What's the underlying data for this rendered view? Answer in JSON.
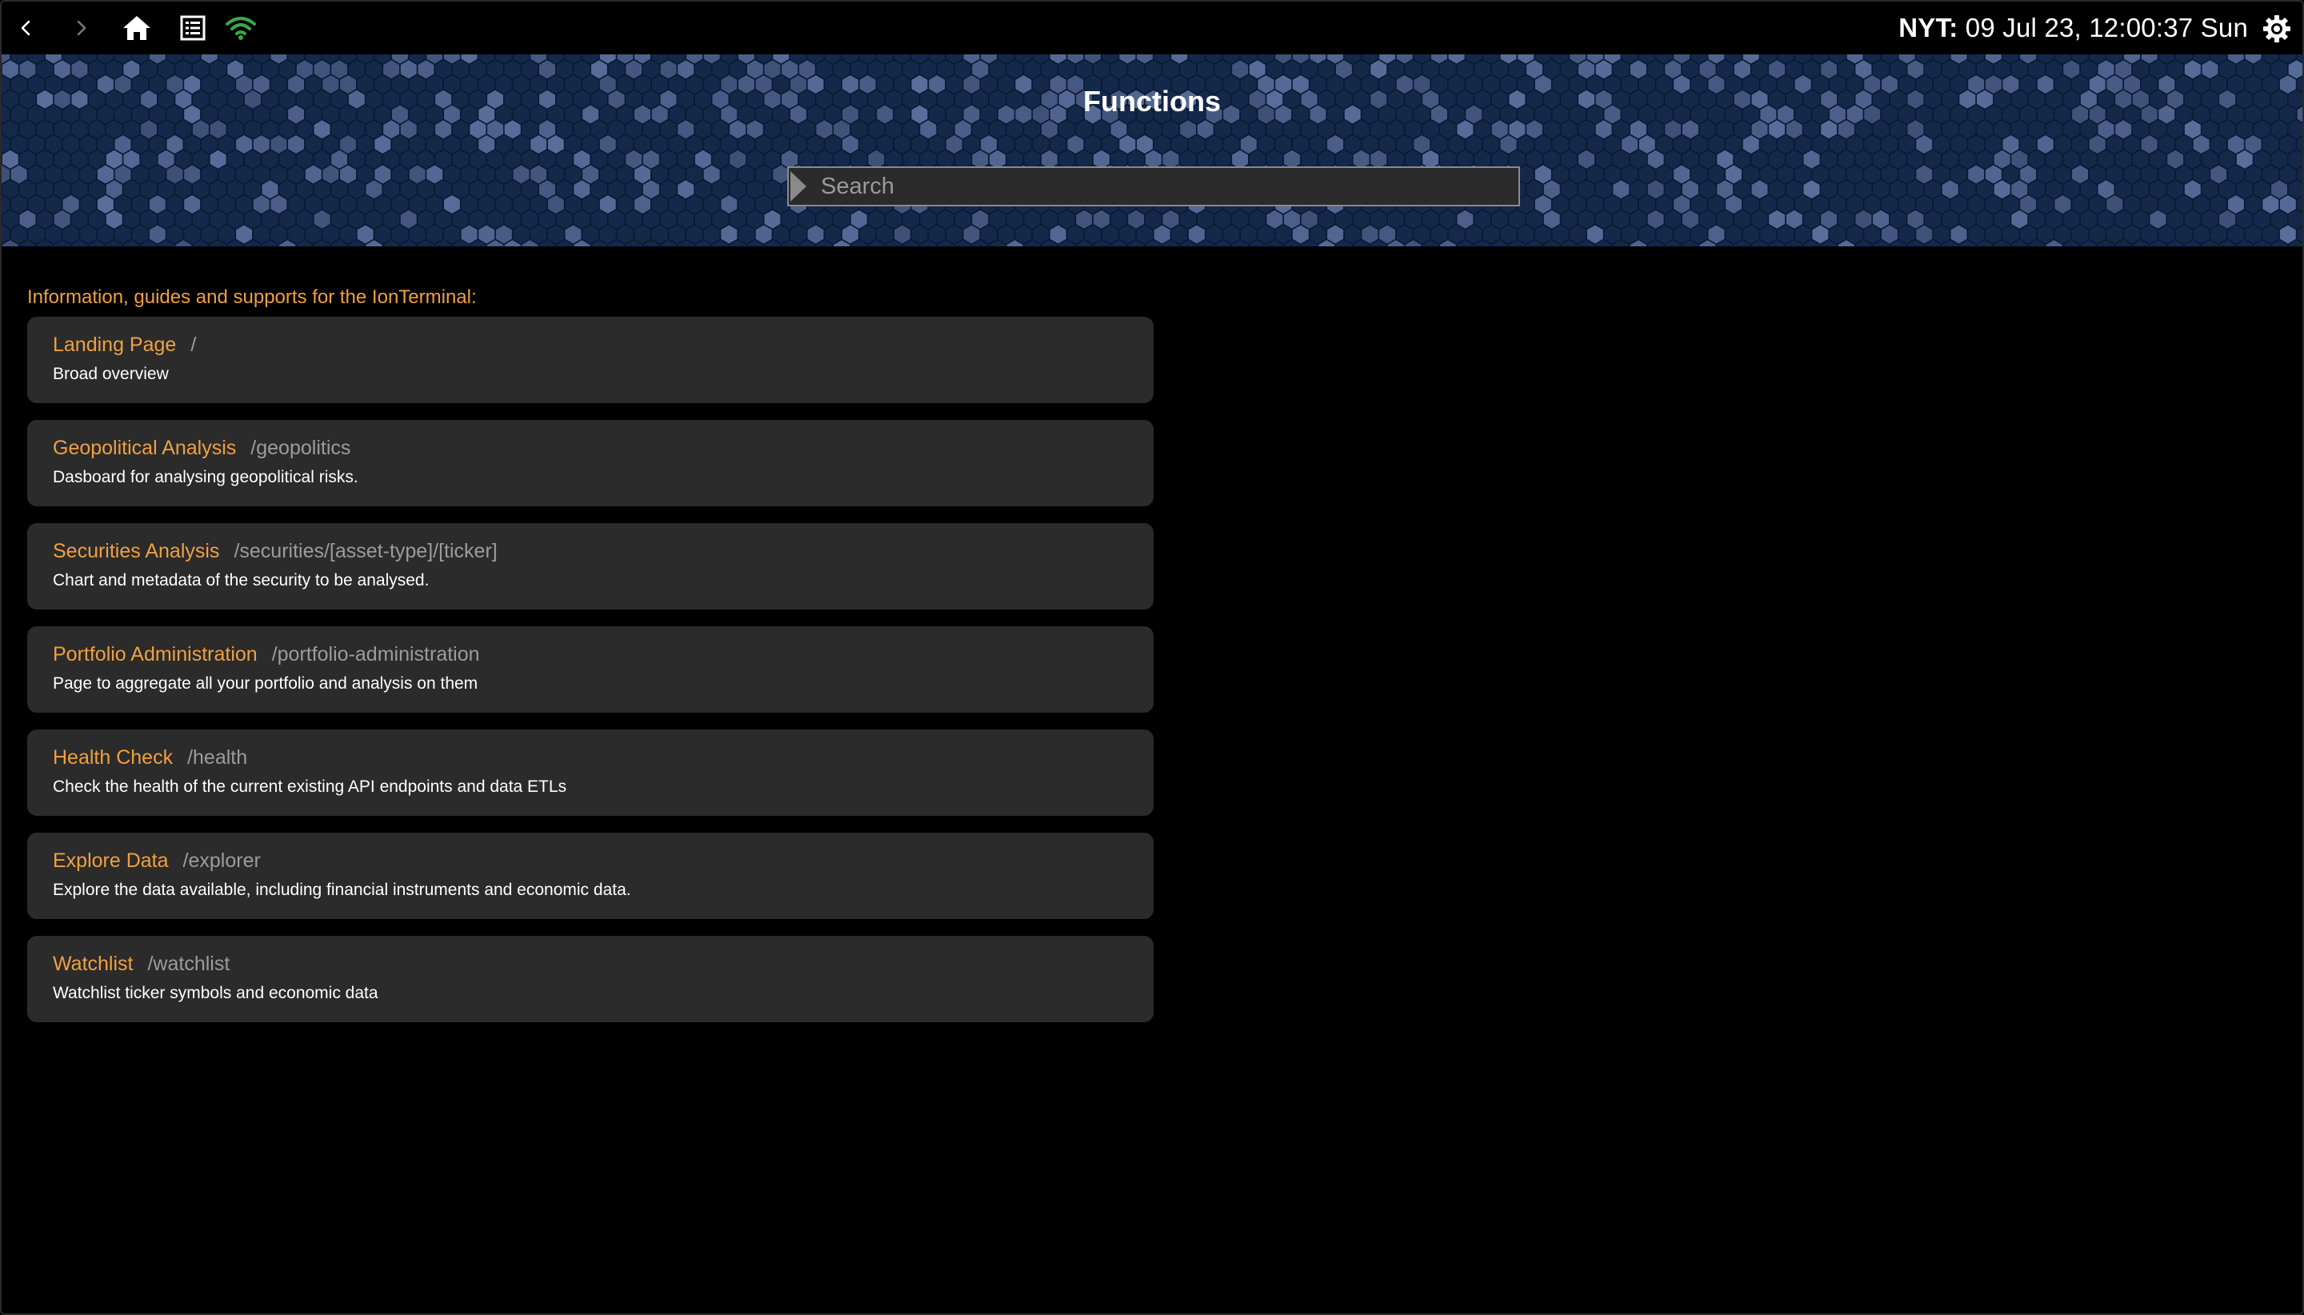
{
  "topbar": {
    "back_icon": "chevron-left-icon",
    "forward_icon": "chevron-right-icon",
    "home_icon": "home-icon",
    "list_icon": "list-icon",
    "wifi_icon": "wifi-icon",
    "clock_label": "NYT:",
    "clock_value": "09 Jul 23, 12:00:37 Sun",
    "settings_icon": "gear-icon",
    "colors": {
      "icon_active": "#ffffff",
      "icon_disabled": "#777777",
      "wifi": "#3aa84a"
    }
  },
  "banner": {
    "title": "Functions",
    "search_placeholder": "Search",
    "search_value": ""
  },
  "main": {
    "intro": "Information, guides and supports for the IonTerminal:",
    "functions": [
      {
        "title": "Landing Page",
        "route": "/",
        "description": "Broad overview"
      },
      {
        "title": "Geopolitical Analysis",
        "route": "/geopolitics",
        "description": "Dasboard for analysing geopolitical risks."
      },
      {
        "title": "Securities Analysis",
        "route": "/securities/[asset-type]/[ticker]",
        "description": "Chart and metadata of the security to be analysed."
      },
      {
        "title": "Portfolio Administration",
        "route": "/portfolio-administration",
        "description": "Page to aggregate all your portfolio and analysis on them"
      },
      {
        "title": "Health Check",
        "route": "/health",
        "description": "Check the health of the current existing API endpoints and data ETLs"
      },
      {
        "title": "Explore Data",
        "route": "/explorer",
        "description": "Explore the data available, including financial instruments and economic data."
      },
      {
        "title": "Watchlist",
        "route": "/watchlist",
        "description": "Watchlist ticker symbols and economic data"
      }
    ]
  },
  "colors": {
    "accent_orange": "#f0a040",
    "route_gray": "#9c9c9c",
    "card_bg": "#2b2b2b",
    "banner_bg": "#0b1a33",
    "hex_dark": "#14284a",
    "hex_light": "#5a6e9c"
  }
}
